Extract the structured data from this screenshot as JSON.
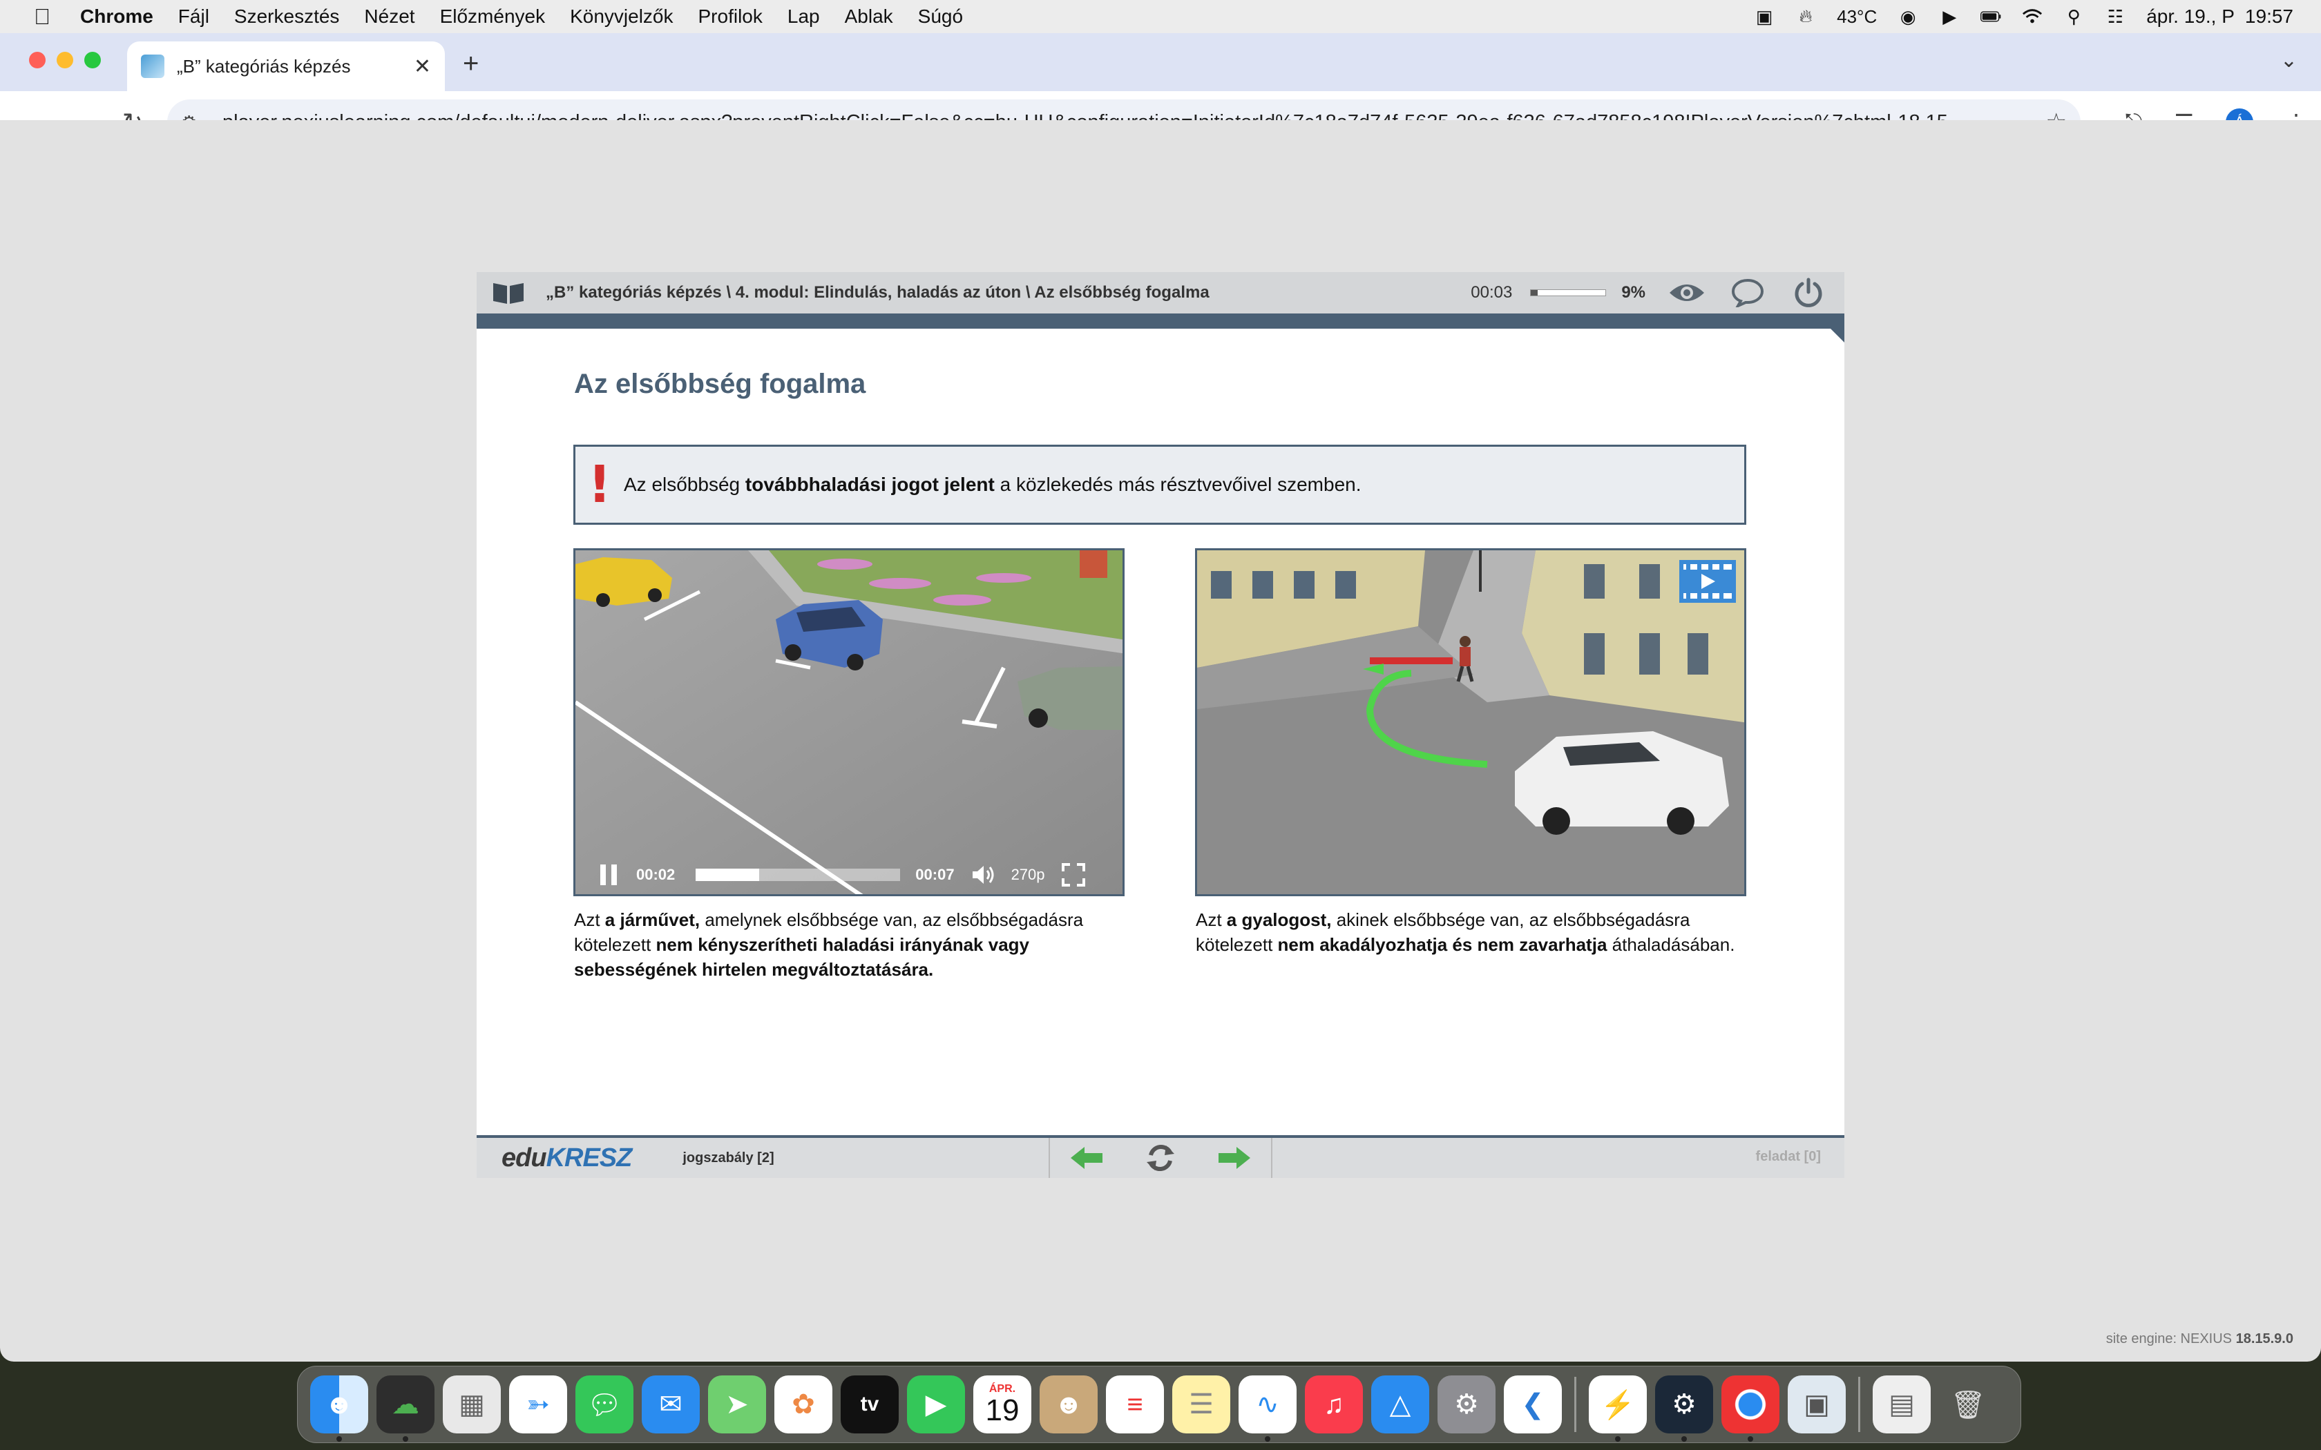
{
  "menubar": {
    "apple": "",
    "app": "Chrome",
    "items": [
      "Fájl",
      "Szerkesztés",
      "Nézet",
      "Előzmények",
      "Könyvjelzők",
      "Profilok",
      "Lap",
      "Ablak",
      "Súgó"
    ],
    "temperature": "43°C",
    "datetime": "ápr. 19., P  19:57"
  },
  "browser": {
    "tab_title": "„B” kategóriás képzés",
    "url": "player.nexiuslearning.com/defaultui/modern-deliver.aspx?preventRightClick=False&cc=hu-HU&configuration=InitiatorId%7c18a7d74f-5635-29ea-f636-67ad7858c198!PlayerVersion%7chtml-18.15...",
    "profile_initial": "Á"
  },
  "player": {
    "breadcrumb": "„B” kategóriás képzés \\ 4. modul: Elindulás, haladás az úton \\ Az elsőbbség fogalma",
    "elapsed": "00:03",
    "progress_fraction": 0.09,
    "progress_label": "9%",
    "page_title": "Az elsőbbség fogalma",
    "notice": {
      "before": "Az elsőbbség ",
      "bold": "továbbhaladási jogot jelent",
      "after": " a közlekedés más résztvevőivel szemben."
    },
    "video_left": {
      "current": "00:02",
      "duration": "00:07",
      "progress_fraction": 0.31,
      "quality": "270p"
    },
    "caption_left": {
      "p1": "Azt ",
      "b1": "a járművet,",
      "p2": " amelynek elsőbbsége van, az elsőbbségadásra kötelezett ",
      "b2": "nem kényszerítheti haladási irányának vagy sebességének hirtelen megváltoztatására."
    },
    "caption_right": {
      "p1": "Azt ",
      "b1": "a gyalogost,",
      "p2": " akinek elsőbbsége van, az elsőbbségadásra kötelezett ",
      "b2": "nem akadályozhatja és nem zavarhatja",
      "p3": " áthaladásában."
    },
    "footer": {
      "logo_edu": "edu",
      "logo_kresz": "KRESZ",
      "jogszabaly": "jogszabály [2]",
      "feladat": "feladat [0]"
    }
  },
  "site_engine": {
    "label": "site engine: NEXIUS ",
    "version": "18.15.9.0"
  },
  "dock": {
    "calendar_month": "ÁPR.",
    "calendar_day": "19"
  },
  "colors": {
    "accent": "#4a6075",
    "alert": "#d42f2f",
    "nav_green": "#4caf50"
  }
}
